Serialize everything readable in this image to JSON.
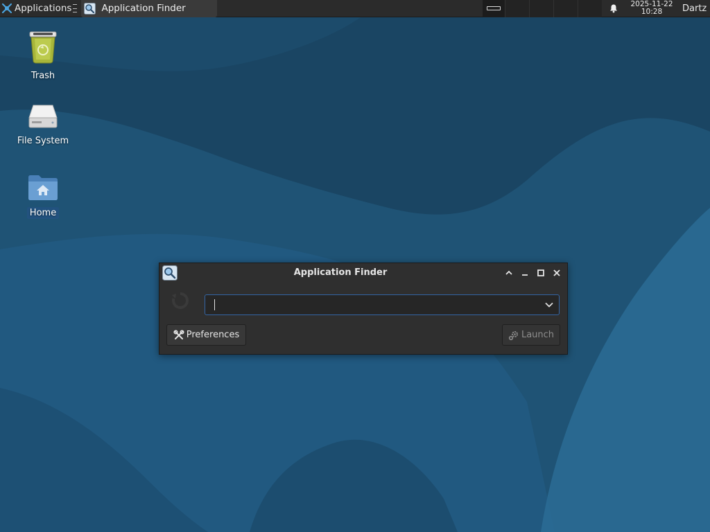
{
  "panel": {
    "apps_label": "Applications",
    "task_label": "Application Finder",
    "clock_date": "2025-11-22",
    "clock_time": "10:28",
    "user": "Dartz",
    "icons": {
      "apps": "xfce-mouse-icon",
      "task": "search-icon",
      "show_desktop": "show-desktop-icon",
      "notifications": "bell-icon"
    }
  },
  "desktop": {
    "icons": [
      {
        "label": "Trash",
        "icon": "trash-icon"
      },
      {
        "label": "File System",
        "icon": "drive-icon"
      },
      {
        "label": "Home",
        "icon": "home-folder-icon",
        "selected": true
      }
    ]
  },
  "finder": {
    "title": "Application Finder",
    "search_value": "",
    "search_placeholder": "",
    "preferences_label": "Preferences",
    "launch_label": "Launch",
    "launch_enabled": false
  },
  "colors": {
    "panel_bg": "#2b2b2b",
    "desktop_bg": "#1d4f72",
    "accent": "#3465a4",
    "selected_label": "#22527f"
  }
}
